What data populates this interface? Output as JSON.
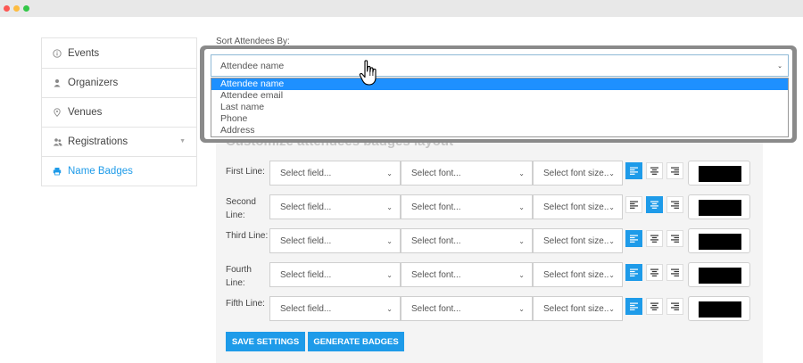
{
  "window": {
    "controls": [
      "close",
      "minimize",
      "maximize"
    ]
  },
  "sidebar": {
    "items": [
      {
        "label": "Events",
        "icon": "info-circle-icon",
        "active": false
      },
      {
        "label": "Organizers",
        "icon": "user-icon",
        "active": false
      },
      {
        "label": "Venues",
        "icon": "map-pin-icon",
        "active": false
      },
      {
        "label": "Registrations",
        "icon": "users-icon",
        "active": false,
        "has_caret": true
      },
      {
        "label": "Name Badges",
        "icon": "print-icon",
        "active": true
      }
    ]
  },
  "sort": {
    "label": "Sort Attendees By:",
    "selected": "Attendee name",
    "options": [
      "Attendee name",
      "Attendee email",
      "Last name",
      "Phone",
      "Address"
    ],
    "highlighted_index": 0
  },
  "badges": {
    "title": "Customize attendees badges layout",
    "lines": [
      {
        "label": "First Line:",
        "field_placeholder": "Select field...",
        "font_placeholder": "Select font...",
        "size_placeholder": "Select font size..",
        "align": "left",
        "color": "#000000"
      },
      {
        "label": "Second Line:",
        "field_placeholder": "Select field...",
        "font_placeholder": "Select font...",
        "size_placeholder": "Select font size..",
        "align": "center",
        "color": "#000000"
      },
      {
        "label": "Third Line:",
        "field_placeholder": "Select field...",
        "font_placeholder": "Select font...",
        "size_placeholder": "Select font size..",
        "align": "left",
        "color": "#000000"
      },
      {
        "label": "Fourth Line:",
        "field_placeholder": "Select field...",
        "font_placeholder": "Select font...",
        "size_placeholder": "Select font size..",
        "align": "left",
        "color": "#000000"
      },
      {
        "label": "Fifth Line:",
        "field_placeholder": "Select field...",
        "font_placeholder": "Select font...",
        "size_placeholder": "Select font size..",
        "align": "left",
        "color": "#000000"
      }
    ],
    "save_label": "SAVE SETTINGS",
    "generate_label": "GENERATE BADGES"
  },
  "colors": {
    "accent": "#1e9be9",
    "highlight": "#1e90ff"
  }
}
